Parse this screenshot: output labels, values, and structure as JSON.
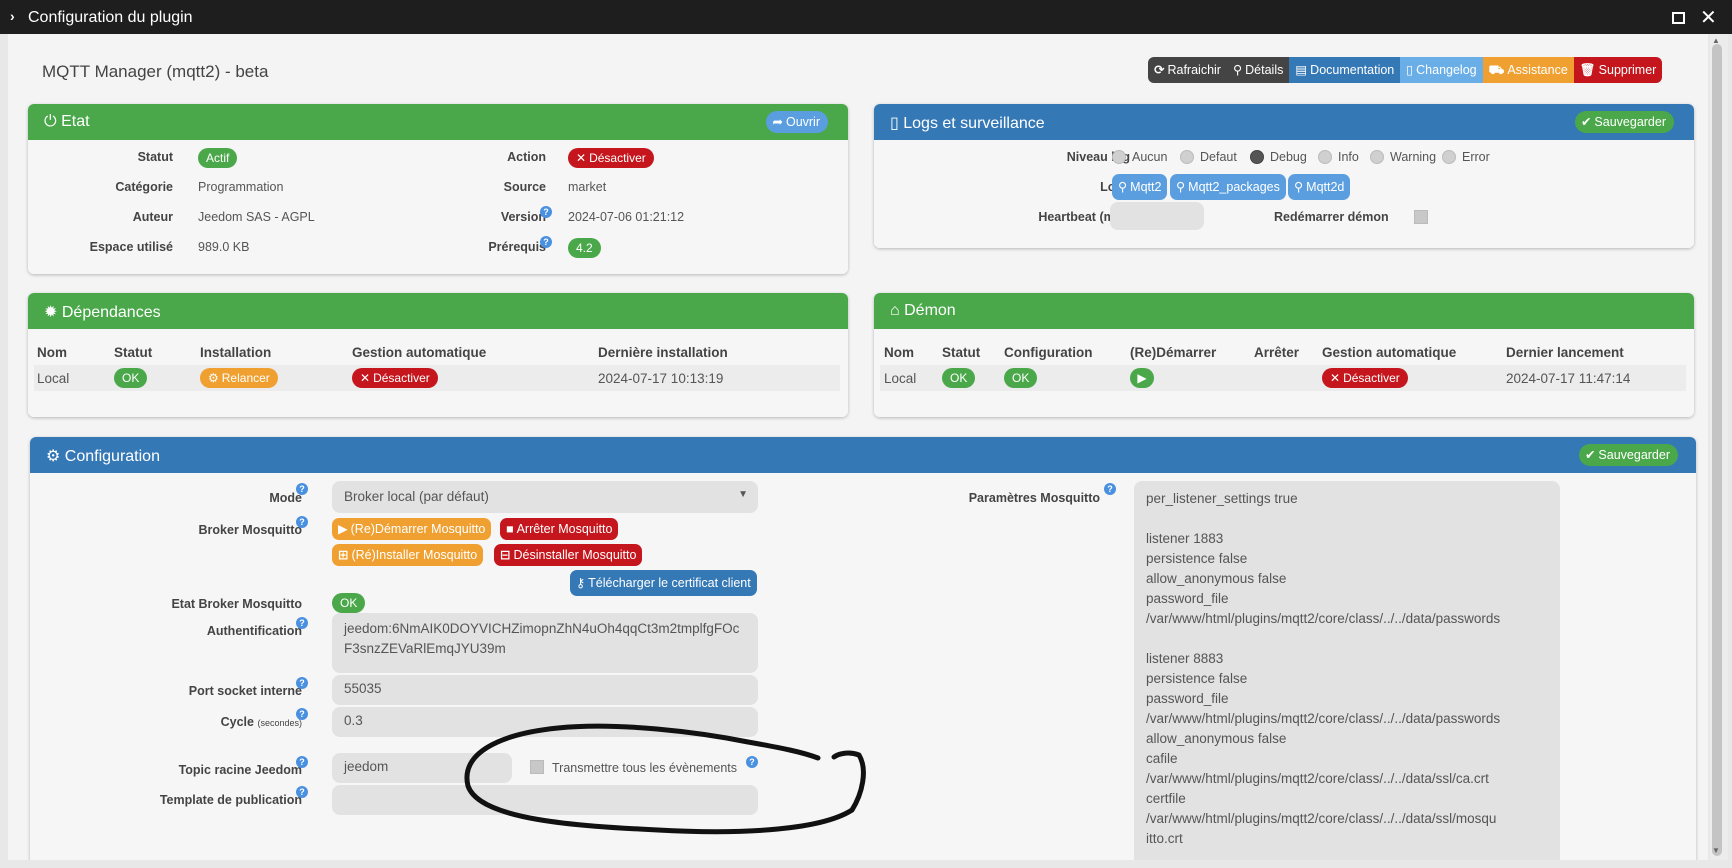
{
  "window": {
    "title": "Configuration du plugin"
  },
  "plugin": {
    "title": "MQTT Manager (mqtt2) - beta"
  },
  "toolbar": [
    {
      "label": "Rafraichir",
      "icon": "refresh-icon",
      "color": "#444444"
    },
    {
      "label": "Détails",
      "icon": "search-icon",
      "color": "#444444"
    },
    {
      "label": "Documentation",
      "icon": "book-icon",
      "color": "#3578b6"
    },
    {
      "label": "Changelog",
      "icon": "file-icon",
      "color": "#6aaee8"
    },
    {
      "label": "Assistance",
      "icon": "truck-icon",
      "color": "#f0a030"
    },
    {
      "label": "Supprimer",
      "icon": "trash-icon",
      "color": "#c4161c"
    }
  ],
  "etat": {
    "title": "Etat",
    "open_label": "Ouvrir",
    "statut_label": "Statut",
    "statut_value": "Actif",
    "categorie_label": "Catégorie",
    "categorie_value": "Programmation",
    "auteur_label": "Auteur",
    "auteur_value": "Jeedom SAS - AGPL",
    "espace_label": "Espace utilisé",
    "espace_value": "989.0 KB",
    "action_label": "Action",
    "action_value": "Désactiver",
    "source_label": "Source",
    "source_value": "market",
    "version_label": "Version",
    "version_value": "2024-07-06 01:21:12",
    "prerequis_label": "Prérequis",
    "prerequis_value": "4.2"
  },
  "logs": {
    "title": "Logs et surveillance",
    "save_label": "Sauvegarder",
    "niveau_label": "Niveau log",
    "levels": [
      "Aucun",
      "Defaut",
      "Debug",
      "Info",
      "Warning",
      "Error"
    ],
    "selected_level": "Debug",
    "logs_label": "Logs",
    "log_buttons": [
      "Mqtt2",
      "Mqtt2_packages",
      "Mqtt2d"
    ],
    "heartbeat_label": "Heartbeat (min)",
    "restart_label": "Redémarrer démon"
  },
  "dependances": {
    "title": "Dépendances",
    "headers": [
      "Nom",
      "Statut",
      "Installation",
      "Gestion automatique",
      "Dernière installation"
    ],
    "row": {
      "nom": "Local",
      "statut": "OK",
      "installation": "Relancer",
      "gestion": "Désactiver",
      "derniere": "2024-07-17 10:13:19"
    }
  },
  "demon": {
    "title": "Démon",
    "headers": [
      "Nom",
      "Statut",
      "Configuration",
      "(Re)Démarrer",
      "Arrêter",
      "Gestion automatique",
      "Dernier lancement"
    ],
    "row": {
      "nom": "Local",
      "statut": "OK",
      "configuration": "OK",
      "gestion": "Désactiver",
      "dernier": "2024-07-17 11:47:14"
    }
  },
  "configuration": {
    "title": "Configuration",
    "save_label": "Sauvegarder",
    "mode_label": "Mode",
    "mode_value": "Broker local (par défaut)",
    "broker_label": "Broker Mosquitto",
    "btn_restart": "(Re)Démarrer Mosquitto",
    "btn_stop": "Arrêter Mosquitto",
    "btn_install": "(Ré)Installer Mosquitto",
    "btn_uninstall": "Désinstaller Mosquitto",
    "btn_cert": "Télécharger le certificat client",
    "etat_broker_label": "Etat Broker Mosquitto",
    "etat_broker_value": "OK",
    "auth_label": "Authentification",
    "auth_value": "jeedom:6NmAIK0DOYVICHZimopnZhN4uOh4qqCt3m2tmplfgFOcF3snzZEVaRlEmqJYU39m",
    "port_label": "Port socket interne",
    "port_value": "55035",
    "cycle_label": "Cycle",
    "cycle_unit": "(secondes)",
    "cycle_value": "0.3",
    "topic_label": "Topic racine Jeedom",
    "topic_value": "jeedom",
    "transmit_label": "Transmettre tous les évènements",
    "template_label": "Template de publication",
    "params_label": "Paramètres Mosquitto",
    "params_value": "per_listener_settings true\n\nlistener 1883\npersistence false\nallow_anonymous false\npassword_file\n/var/www/html/plugins/mqtt2/core/class/../../data/passwords\n\nlistener 8883\npersistence false\npassword_file\n/var/www/html/plugins/mqtt2/core/class/../../data/passwords\nallow_anonymous false\ncafile\n/var/www/html/plugins/mqtt2/core/class/../../data/ssl/ca.crt\ncertfile\n/var/www/html/plugins/mqtt2/core/class/../../data/ssl/mosqu\nitto.crt"
  },
  "colors": {
    "green": "#4aa84a",
    "blue": "#3578b6",
    "red": "#c4161c",
    "orange": "#f0a030"
  }
}
